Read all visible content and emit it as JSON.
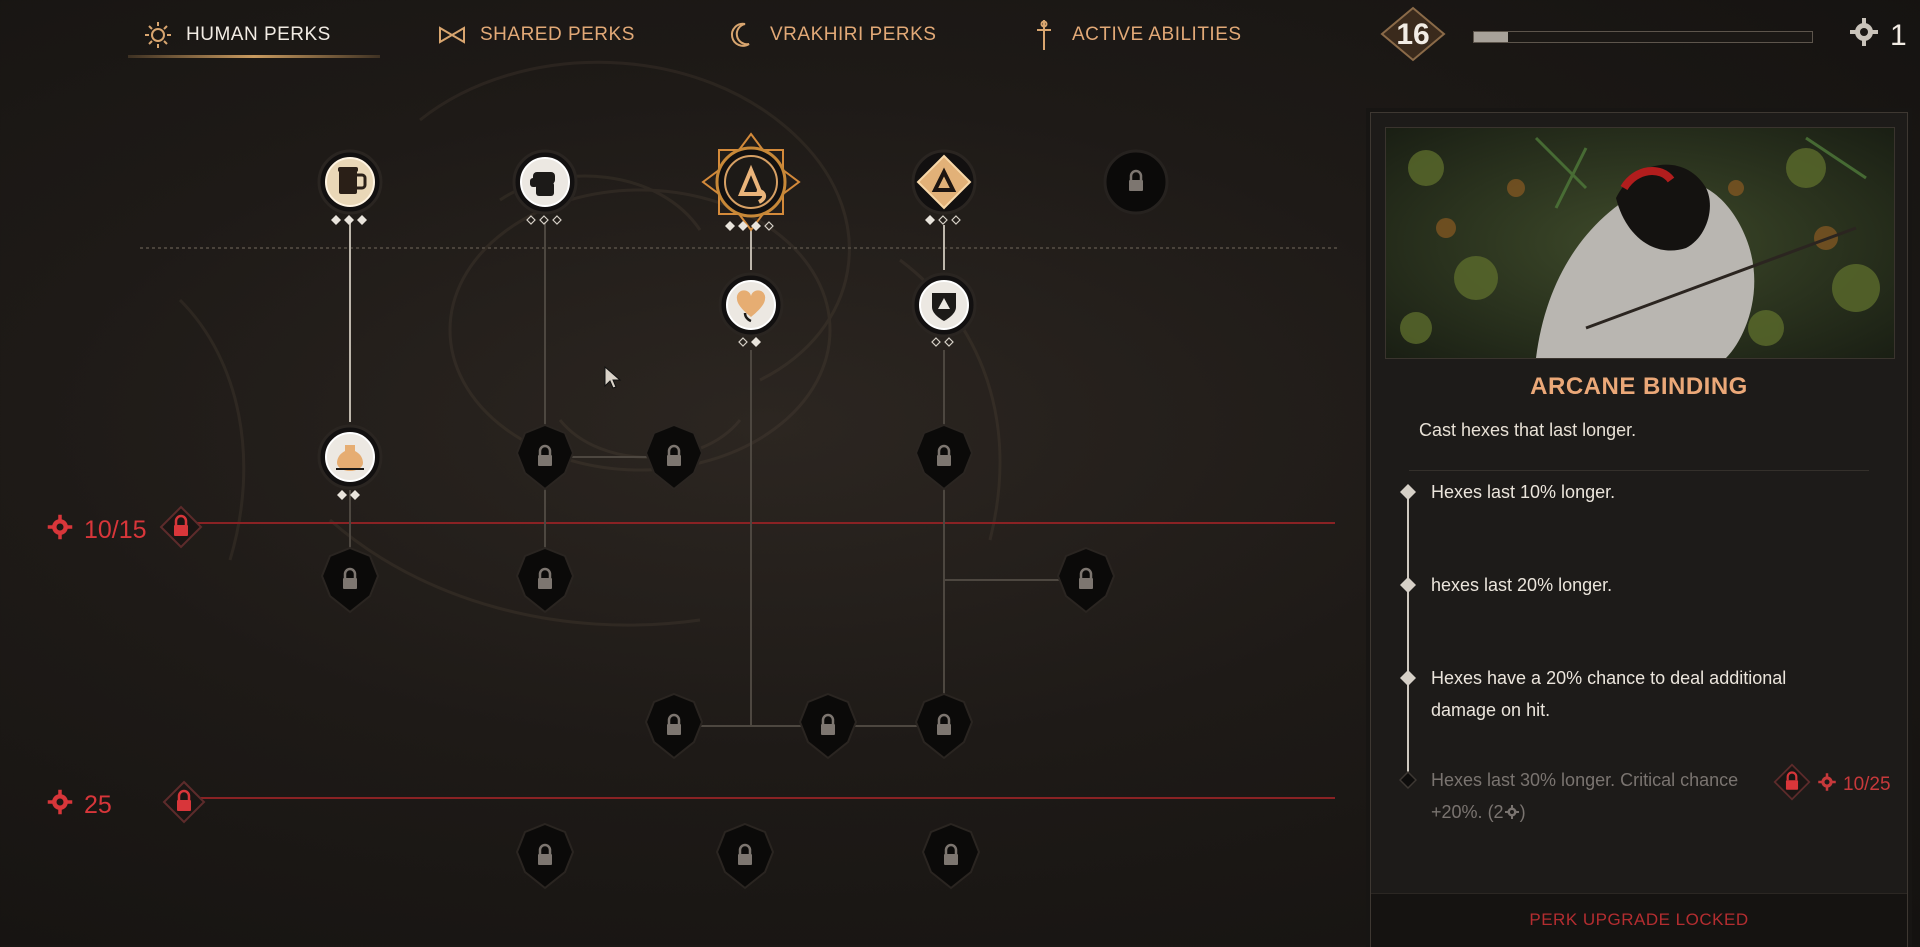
{
  "nav": {
    "tabs": [
      {
        "label": "HUMAN PERKS",
        "icon": "sun-icon",
        "active": true
      },
      {
        "label": "SHARED PERKS",
        "icon": "bowtie-icon",
        "active": false
      },
      {
        "label": "VRAKHIRI PERKS",
        "icon": "crescent-moon-icon",
        "active": false
      },
      {
        "label": "ACTIVE ABILITIES",
        "icon": "dagger-icon",
        "active": false
      }
    ],
    "level": "16",
    "xp_progress_fraction": 0.1,
    "perk_points": "1"
  },
  "tree": {
    "thresholds": [
      {
        "label": "10/15"
      },
      {
        "label": "25"
      }
    ],
    "nodes": [
      {
        "id": "tankard",
        "icon": "tankard-icon",
        "state": "owned",
        "ranks": [
          1,
          1,
          1
        ]
      },
      {
        "id": "fist",
        "icon": "fist-icon",
        "state": "available",
        "ranks": [
          0,
          0,
          0
        ]
      },
      {
        "id": "arcane-binding",
        "icon": "arcane-binding-icon",
        "state": "selected",
        "ranks": [
          1,
          1,
          1,
          0
        ]
      },
      {
        "id": "arcane-triangle",
        "icon": "arcane-triangle-icon",
        "state": "owned",
        "ranks": [
          1,
          0,
          0
        ]
      },
      {
        "id": "top-locked",
        "icon": "lock-icon",
        "state": "locked",
        "ranks": []
      },
      {
        "id": "heart",
        "icon": "heart-icon",
        "state": "owned",
        "ranks": [
          0,
          1
        ]
      },
      {
        "id": "shield",
        "icon": "shield-icon",
        "state": "available",
        "ranks": [
          0,
          0
        ]
      },
      {
        "id": "potion",
        "icon": "potion-icon",
        "state": "owned",
        "ranks": [
          1,
          1
        ]
      }
    ]
  },
  "perk": {
    "title": "ARCANE BINDING",
    "description": "Cast hexes that last longer.",
    "tiers": [
      {
        "text": "Hexes last 10% longer.",
        "unlocked": true
      },
      {
        "text": "hexes last 20% longer.",
        "unlocked": true
      },
      {
        "text": "Hexes have a 20% chance to deal additional damage on hit.",
        "unlocked": true
      },
      {
        "text": "Hexes last 30% longer. Critical chance +20%.",
        "cost": "(2",
        "cost_close": ")",
        "unlocked": false
      }
    ],
    "requirement": "10/25",
    "footer": "PERK UPGRADE LOCKED"
  },
  "colors": {
    "accent": "#e2a977",
    "locked_red": "#c7393b",
    "panel_bg": "#1d1b19"
  }
}
